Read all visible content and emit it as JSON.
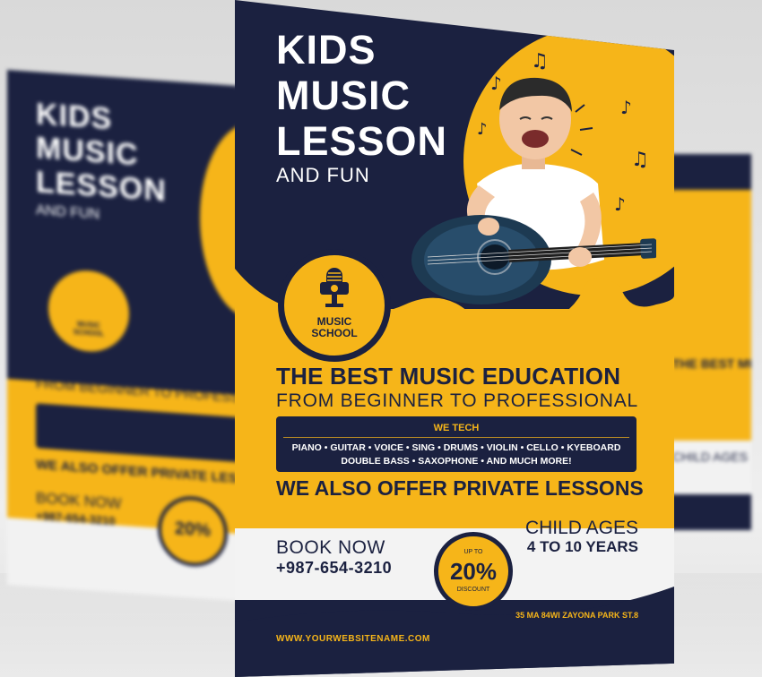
{
  "flyer": {
    "title_lines": [
      "KIDS",
      "MUSIC",
      "LESSON"
    ],
    "subtitle": "AND FUN",
    "logo_text_line1": "MUSIC",
    "logo_text_line2": "SCHOOL",
    "headline": "THE BEST MUSIC EDUCATION",
    "subheadline": "FROM BEGINNER TO PROFESSIONAL",
    "box_heading": "WE TECH",
    "courses_line1": "PIANO • GUITAR • VOICE • SING • DRUMS • VIOLIN • CELLO • KYEBOARD",
    "courses_line2": "DOUBLE BASS • SAXOPHONE • AND MUCH MORE!",
    "private_lessons": "WE ALSO OFFER PRIVATE LESSONS",
    "book_now": "BOOK NOW",
    "phone": "+987-654-3210",
    "discount_up_to": "UP TO",
    "discount_value": "20%",
    "discount_label": "DISCOUNT",
    "child_ages_label": "CHILD AGES",
    "child_ages_value": "4 TO 10 YEARS",
    "address": "35 MA 84WI ZAYONA PARK ST.8",
    "website": "WWW.YOURWEBSITENAME.COM"
  },
  "colors": {
    "navy": "#1b2140",
    "yellow": "#f6b519",
    "white": "#f3f3f3"
  }
}
